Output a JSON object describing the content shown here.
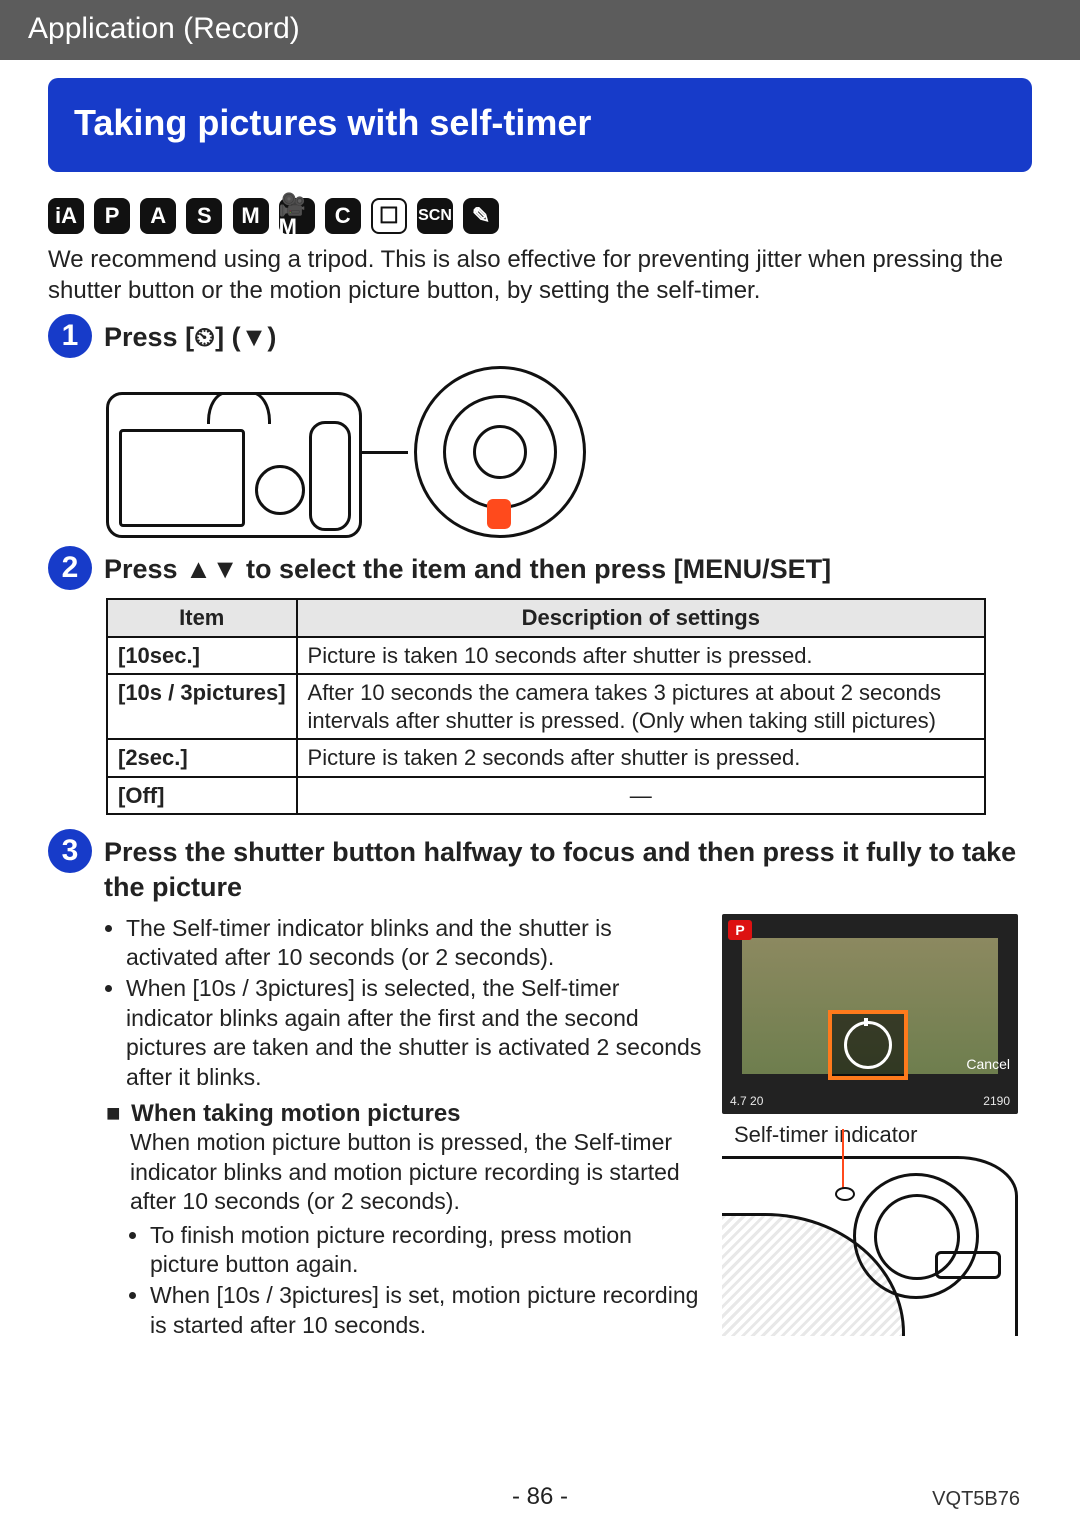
{
  "header": {
    "section_title": "Application (Record)"
  },
  "title": "Taking pictures with self-timer",
  "modes": [
    "iA",
    "P",
    "A",
    "S",
    "M",
    "🎥M",
    "C",
    "☐",
    "SCN",
    "✎"
  ],
  "intro": "We recommend using a tripod. This is also effective for preventing jitter when pressing the shutter button or the motion picture button, by setting the self-timer.",
  "steps": {
    "s1": {
      "num": "1",
      "title": "Press [⏲] (▼)"
    },
    "s2": {
      "num": "2",
      "title": "Press ▲▼ to select the item and then press [MENU/SET]",
      "table": {
        "headers": {
          "item": "Item",
          "desc": "Description of settings"
        },
        "rows": [
          {
            "item": "[10sec.]",
            "desc": "Picture is taken 10 seconds after shutter is pressed."
          },
          {
            "item": "[10s / 3pictures]",
            "desc": "After 10 seconds the camera takes 3 pictures at about 2 seconds intervals after shutter is pressed. (Only when taking still pictures)"
          },
          {
            "item": "[2sec.]",
            "desc": "Picture is taken 2 seconds after shutter is pressed."
          },
          {
            "item": "[Off]",
            "desc": "—"
          }
        ]
      }
    },
    "s3": {
      "num": "3",
      "title": "Press the shutter button halfway to focus and then press it fully to take the picture",
      "bullets": [
        "The Self-timer indicator blinks and the shutter is activated after 10 seconds (or 2 seconds).",
        "When [10s / 3pictures] is selected, the Self-timer indicator blinks again after the first and the second pictures are taken and the shutter is activated 2 seconds after it blinks."
      ],
      "motion": {
        "heading": "When taking motion pictures",
        "text": "When motion picture button is pressed, the Self-timer indicator blinks and motion picture recording is started after 10 seconds (or 2 seconds).",
        "bullets": [
          "To finish motion picture recording, press motion picture button again.",
          "When [10s / 3pictures] is set, motion picture recording is started after 10 seconds."
        ]
      },
      "screenshot": {
        "p_badge": "P",
        "cancel": "Cancel",
        "info_left": "4.7   20",
        "info_right": "2190"
      },
      "indicator_caption": "Self-timer indicator"
    }
  },
  "footer": {
    "page": "- 86 -",
    "doc_id": "VQT5B76"
  }
}
